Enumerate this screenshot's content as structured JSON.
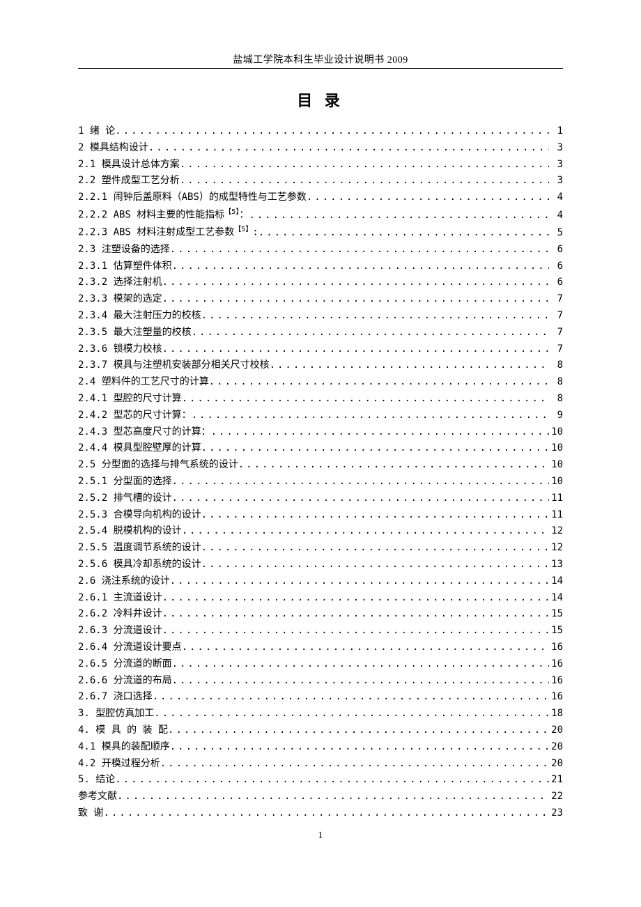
{
  "header": "盐城工学院本科生毕业设计说明书  2009",
  "title": "目 录",
  "page_number": "1",
  "toc": [
    {
      "label": "1 绪   论",
      "page": "1"
    },
    {
      "label": "2 模具结构设计",
      "page": "3"
    },
    {
      "label": "2.1 模具设计总体方案 ",
      "page": "3"
    },
    {
      "label": "2.2 塑件成型工艺分析 ",
      "page": "3"
    },
    {
      "label": "2.2.1 闹钟后盖原料（ABS）的成型特性与工艺参数",
      "page": "4"
    },
    {
      "label": "2.2.2 ABS 材料主要的性能指标",
      "sup": "【5】",
      "tail": "：",
      "page": "4"
    },
    {
      "label": "2.2.3 ABS 材料注射成型工艺参数",
      "sup": "【5】",
      "tail": ":",
      "page": "5"
    },
    {
      "label": "2.3 注塑设备的选择 ",
      "page": "6"
    },
    {
      "label": "2.3.1 估算塑件体积",
      "page": "6"
    },
    {
      "label": "2.3.2 选择注射机",
      "page": "6"
    },
    {
      "label": "2.3.3 模架的选定",
      "page": "7"
    },
    {
      "label": "2.3.4 最大注射压力的校核",
      "page": "7"
    },
    {
      "label": "2.3.5 最大注塑量的校核",
      "page": "7"
    },
    {
      "label": "2.3.6 锁模力校核",
      "page": "7"
    },
    {
      "label": "2.3.7 模具与注塑机安装部分相关尺寸校核",
      "page": "8"
    },
    {
      "label": "2.4 塑料件的工艺尺寸的计算",
      "page": "8"
    },
    {
      "label": "2.4.1 型腔的尺寸计算",
      "page": "8"
    },
    {
      "label": "2.4.2 型芯的尺寸计算：",
      "page": "9"
    },
    {
      "label": "2.4.3 型芯高度尺寸的计算：",
      "page": "10"
    },
    {
      "label": "2.4.4 模具型腔壁厚的计算",
      "page": "10"
    },
    {
      "label": "2.5 分型面的选择与排气系统的设计",
      "page": "10"
    },
    {
      "label": "2.5.1 分型面的选择",
      "page": "10"
    },
    {
      "label": "2.5.2 排气槽的设计",
      "page": "11"
    },
    {
      "label": "2.5.3 合模导向机构的设计",
      "page": "11"
    },
    {
      "label": "2.5.4 脱模机构的设计",
      "page": "12"
    },
    {
      "label": "2.5.5 温度调节系统的设计",
      "page": "12"
    },
    {
      "label": "2.5.6 模具冷却系统的设计",
      "page": "13"
    },
    {
      "label": "2.6 浇注系统的设计",
      "page": "14"
    },
    {
      "label": "2.6.1 主流道设计",
      "page": "14"
    },
    {
      "label": "2.6.2 冷料井设计",
      "page": "15"
    },
    {
      "label": "2.6.3 分流道设计",
      "page": "15"
    },
    {
      "label": "2.6.4 分流道设计要点",
      "page": "16"
    },
    {
      "label": "2.6.5 分流道的断面",
      "page": "16"
    },
    {
      "label": "2.6.6 分流道的布局",
      "page": "16"
    },
    {
      "label": "2.6.7 浇口选择",
      "page": "16"
    },
    {
      "label": "3.  型腔仿真加工",
      "page": "18"
    },
    {
      "label": "4. 模 具 的 装 配",
      "page": "20"
    },
    {
      "label": "4.1  模具的装配顺序",
      "page": "20"
    },
    {
      "label": "4.2  开模过程分析",
      "page": "20"
    },
    {
      "label": "5. 结论",
      "page": "21"
    },
    {
      "label": "参考文献",
      "page": "22"
    },
    {
      "label": "致   谢",
      "page": "23"
    }
  ]
}
